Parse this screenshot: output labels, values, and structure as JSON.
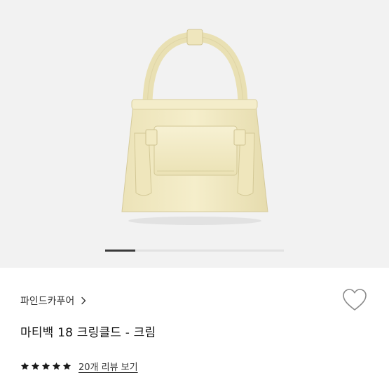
{
  "gallery": {
    "image_name": "cream-mini-handbag",
    "image_color": "#f3ecc6",
    "carousel_progress": 0.17
  },
  "product": {
    "brand": "파인드카푸어",
    "brand_chevron_icon": "chevron-right-icon",
    "title": "마티백 18 크링클드 - 크림",
    "wish_icon": "heart-outline-icon"
  },
  "rating": {
    "stars": 5,
    "star_icon": "star-filled-icon",
    "review_link": "20개 리뷰 보기"
  }
}
